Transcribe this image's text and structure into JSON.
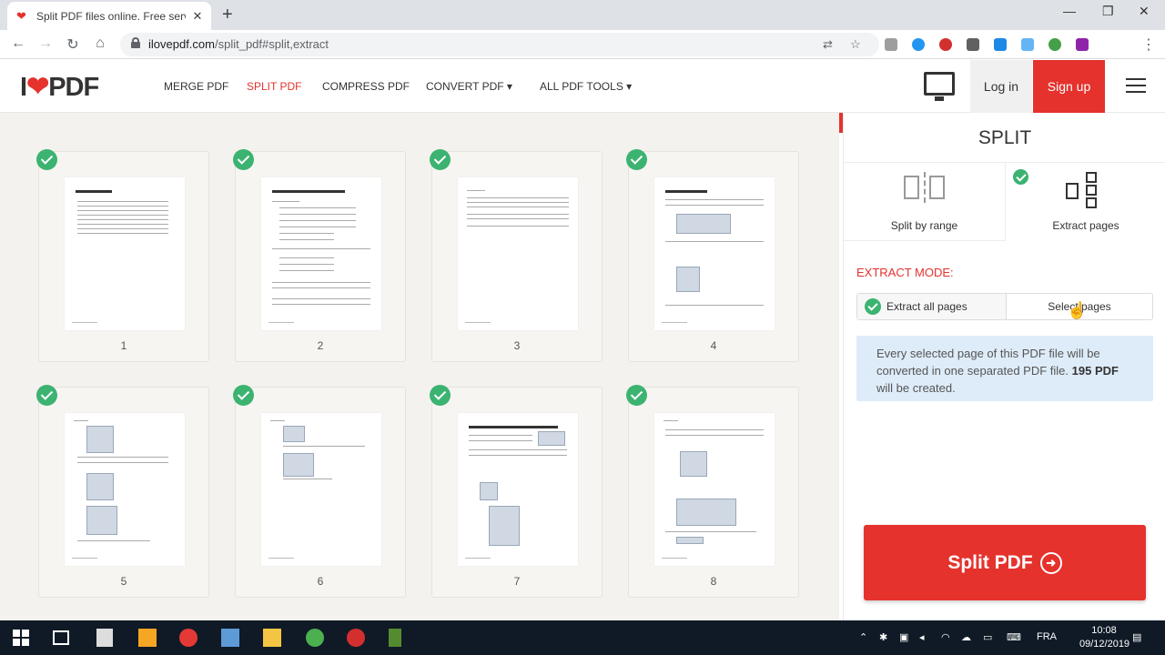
{
  "browser": {
    "tab_title": "Split PDF files online. Free service",
    "tab_close": "✕",
    "new_tab": "+",
    "url_host": "ilovepdf.com",
    "url_path": "/split_pdf#split,extract"
  },
  "site": {
    "logo_prefix": "I",
    "logo_heart": "❤",
    "logo_suffix": "PDF",
    "nav": {
      "merge": "MERGE PDF",
      "split": "SPLIT PDF",
      "compress": "COMPRESS PDF",
      "convert": "CONVERT PDF ▾",
      "all_tools": "ALL PDF TOOLS ▾"
    },
    "login": "Log in",
    "signup": "Sign up",
    "accent_color": "#e5322d"
  },
  "pages": [
    {
      "number": "1",
      "title": "Table of Contents"
    },
    {
      "number": "2",
      "title": "Introduction to the ArcGIS 3D Analyst tutorial"
    },
    {
      "number": "3",
      "title": ""
    },
    {
      "number": "4",
      "title": "Copying the tutorial data"
    },
    {
      "number": "5",
      "title": ""
    },
    {
      "number": "6",
      "title": ""
    },
    {
      "number": "7",
      "title": "Exercise 1: Draping an image over a terrain surface"
    },
    {
      "number": "8",
      "title": ""
    }
  ],
  "sidebar": {
    "title": "SPLIT",
    "mode_range": "Split by range",
    "mode_extract": "Extract pages",
    "extract_mode_label": "EXTRACT MODE:",
    "option_all": "Extract all pages",
    "option_select": "Select pages",
    "info_line1": "Every selected page of this PDF file will be converted in one separated PDF file.",
    "info_count": "195 PDF",
    "info_line2": "will be created.",
    "split_button": "Split PDF",
    "split_arrow": "➜"
  },
  "taskbar": {
    "language": "FRA",
    "time": "10:08",
    "date": "09/12/2019"
  }
}
